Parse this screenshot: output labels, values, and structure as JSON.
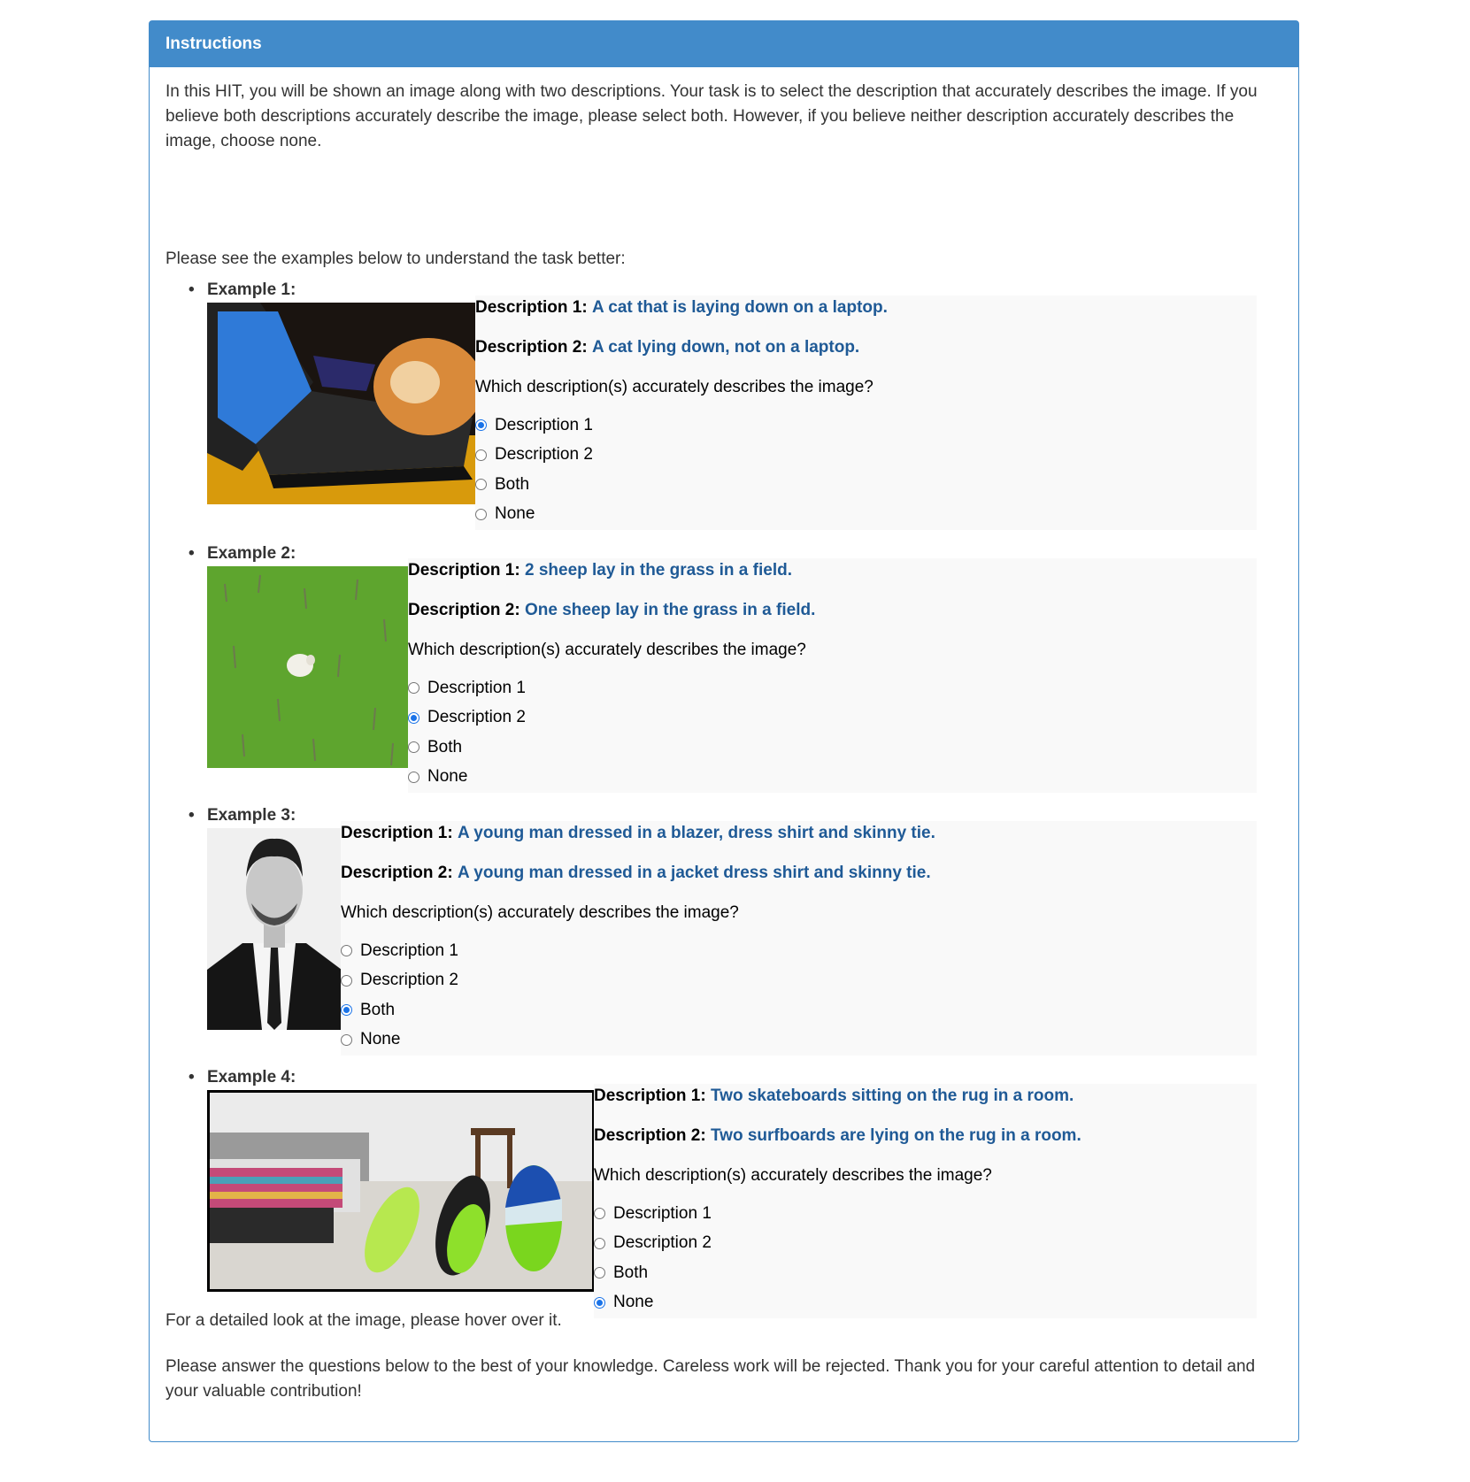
{
  "panel": {
    "title": "Instructions",
    "intro": "In this HIT, you will be shown an image along with two descriptions. Your task is to select the description that accurately describes the image. If you believe both descriptions accurately describe the image, please select both. However, if you believe neither description accurately describes the image, choose none.",
    "see_examples": "Please see the examples below to understand the task better:",
    "hover_note": "For a detailed look at the image, please hover over it.",
    "closing": "Please answer the questions below to the best of your knowledge. Careless work will be rejected. Thank you for your careful attention to detail and your valuable contribution!"
  },
  "common": {
    "bullet": "•",
    "d1_label": "Description 1:",
    "d2_label": "Description 2:",
    "question": "Which description(s) accurately describes the image?",
    "options": [
      "Description 1",
      "Description 2",
      "Both",
      "None"
    ]
  },
  "examples": [
    {
      "label": "Example 1:",
      "image": "cat-on-laptop-photo",
      "d1": "A cat that is laying down on a laptop.",
      "d2": "A cat lying down, not on a laptop.",
      "selected": "Description 1"
    },
    {
      "label": "Example 2:",
      "image": "sheep-in-field-photo",
      "d1": "2 sheep lay in the grass in a field.",
      "d2": "One sheep lay in the grass in a field.",
      "selected": "Description 2"
    },
    {
      "label": "Example 3:",
      "image": "man-in-suit-photo",
      "d1": "A young man dressed in a blazer, dress shirt and skinny tie.",
      "d2": "A young man dressed in a jacket dress shirt and skinny tie.",
      "selected": "Both"
    },
    {
      "label": "Example 4:",
      "image": "surfboards-on-rug-photo",
      "d1": "Two skateboards sitting on the rug in a room.",
      "d2": "Two surfboards are lying on the rug in a room.",
      "selected": "None"
    }
  ],
  "colors": {
    "header": "#428bca",
    "description_text": "#1f5a96",
    "radio_checked": "#1a73e8"
  }
}
